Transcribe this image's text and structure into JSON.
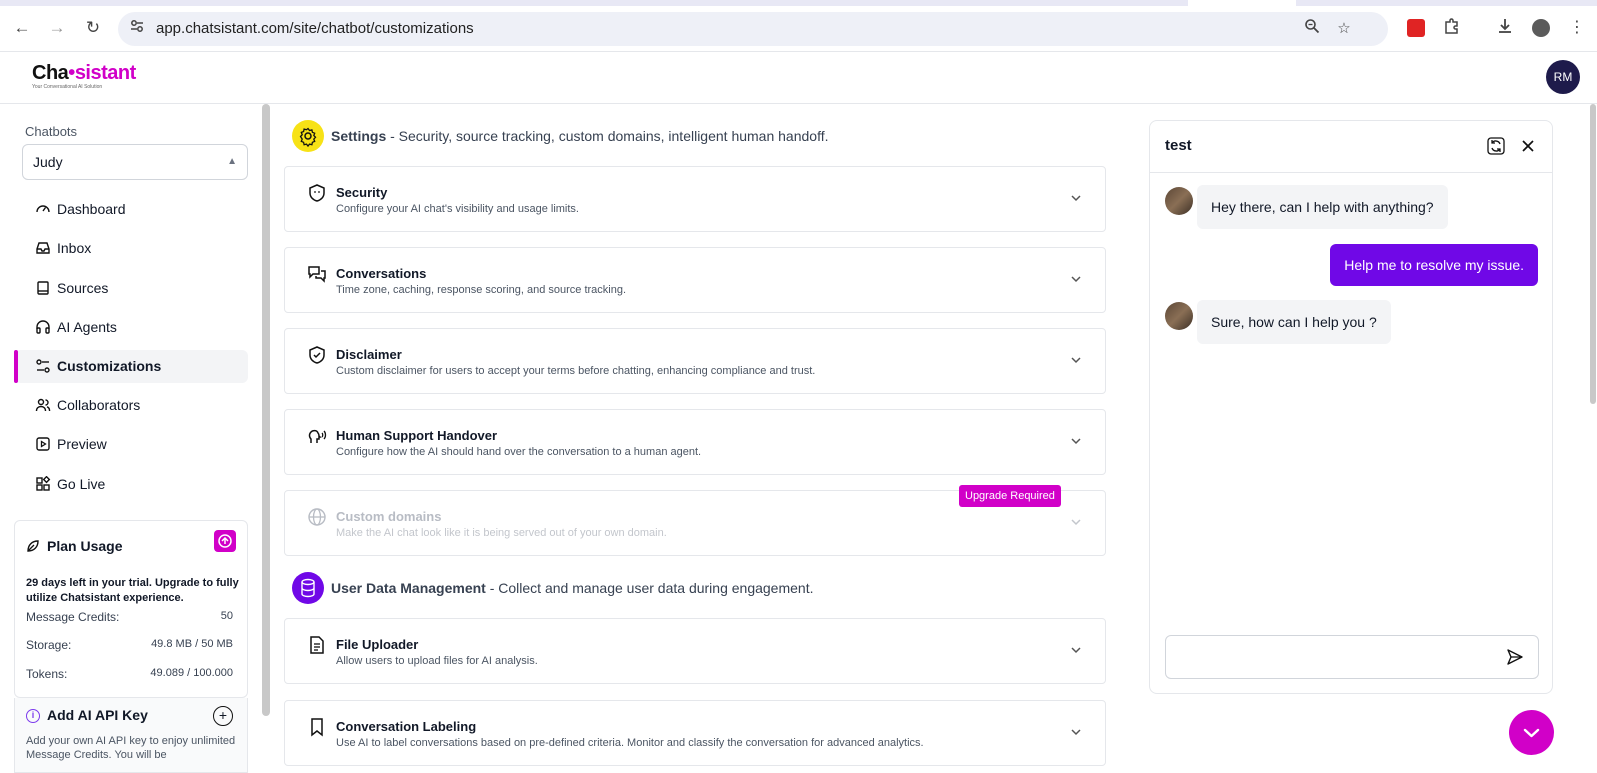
{
  "browser": {
    "url": "app.chatsistant.com/site/chatbot/customizations"
  },
  "header": {
    "logo_text_a": "Cha",
    "logo_text_b": "sistant",
    "logo_tagline": "Your Conversational AI Solution",
    "avatar_initials": "RM"
  },
  "sidebar": {
    "chatbots_label": "Chatbots",
    "selected_chatbot": "Judy",
    "items": [
      {
        "label": "Dashboard",
        "icon": "gauge-icon"
      },
      {
        "label": "Inbox",
        "icon": "inbox-icon"
      },
      {
        "label": "Sources",
        "icon": "book-icon"
      },
      {
        "label": "AI Agents",
        "icon": "headphones-icon"
      },
      {
        "label": "Customizations",
        "icon": "sliders-icon",
        "active": true
      },
      {
        "label": "Collaborators",
        "icon": "users-icon"
      },
      {
        "label": "Preview",
        "icon": "play-square-icon"
      },
      {
        "label": "Go Live",
        "icon": "widgets-icon"
      }
    ],
    "plan": {
      "title": "Plan Usage",
      "message": "29 days left in your trial. Upgrade to fully utilize Chatsistant experience.",
      "rows": [
        {
          "label": "Message Credits:",
          "value": "50"
        },
        {
          "label": "Storage:",
          "value": "49.8 MB / 50 MB"
        },
        {
          "label": "Tokens:",
          "value": "49.089 / 100.000"
        }
      ]
    },
    "api": {
      "title": "Add AI API Key",
      "desc": "Add your own AI API key to enjoy unlimited Message Credits. You will be"
    }
  },
  "main": {
    "settings_section": {
      "title": "Settings",
      "subtitle": " - Security, source tracking, custom domains, intelligent human handoff."
    },
    "settings_items": [
      {
        "title": "Security",
        "desc": "Configure your AI chat's visibility and usage limits.",
        "icon": "shield-icon"
      },
      {
        "title": "Conversations",
        "desc": "Time zone, caching, response scoring, and source tracking.",
        "icon": "chat-bubbles-icon"
      },
      {
        "title": "Disclaimer",
        "desc": "Custom disclaimer for users to accept your terms before chatting, enhancing compliance and trust.",
        "icon": "shield-check-icon"
      },
      {
        "title": "Human Support Handover",
        "desc": "Configure how the AI should hand over the conversation to a human agent.",
        "icon": "head-voice-icon"
      },
      {
        "title": "Custom domains",
        "desc": "Make the AI chat look like it is being served out of your own domain.",
        "icon": "globe-icon",
        "disabled": true
      }
    ],
    "upgrade_badge": "Upgrade Required",
    "user_data_section": {
      "title": "User Data Management",
      "subtitle": " - Collect and manage user data during engagement."
    },
    "user_data_items": [
      {
        "title": "File Uploader",
        "desc": "Allow users to upload files for AI analysis.",
        "icon": "file-icon"
      },
      {
        "title": "Conversation Labeling",
        "desc": "Use AI to label conversations based on pre-defined criteria. Monitor and classify the conversation for advanced analytics.",
        "icon": "bookmark-icon"
      }
    ]
  },
  "chat": {
    "title": "test",
    "messages": [
      {
        "from": "bot",
        "text": "Hey there, can I help with anything?"
      },
      {
        "from": "user",
        "text": "Help me to resolve my issue."
      },
      {
        "from": "bot",
        "text": "Sure, how can I help you ?"
      }
    ],
    "input_value": ""
  },
  "colors": {
    "accent": "#d100c8",
    "user_bubble": "#7008e7",
    "settings_icon_bg": "#f7e216",
    "user_data_icon_bg": "#7008e7"
  }
}
